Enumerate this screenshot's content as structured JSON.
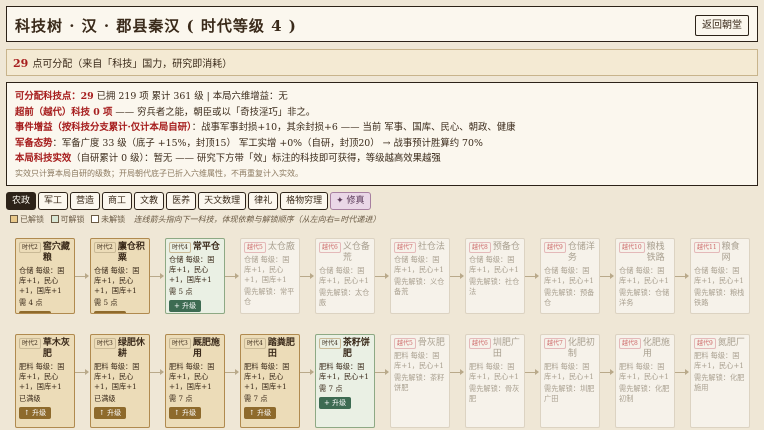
{
  "header": {
    "title": "科技树 · 汉 · 郡县秦汉 ( 时代等级 4 )",
    "back_label": "返回朝堂"
  },
  "points_bar": {
    "num": "29",
    "text": "点可分配（来自「科技」国力，研究即消耗）"
  },
  "stats": {
    "line1_label": "可分配科技点：29",
    "line1_rest": "   已拥 219 项   累计 361 级   |   本局六维增益：无",
    "line2_label": "超前（越代）科技 0 项",
    "line2_rest": " —— 穷兵者之能，朝臣或以「奇技淫巧」非之。",
    "line3_label": "事件增益（按科技分支累计·仅计本局自研）",
    "line3_rest": "：战事军事封损+10，其余封损+6 —— 当前 军事、国库、民心、朝政、健康",
    "line4_label": "军备态势",
    "line4_rest": "：军备广度 33 级（底子 +15%，封顶15）  军工实增 +0%（自研，封顶20） → 战事预计胜算约 70%",
    "line5_label": "本局科技实效",
    "line5_rest": "（自研累计 0 级）：暂无 —— 研究下方带「效」标注的科技即可获得，等级越高效果越强",
    "note": "实效只计算本局自研的级数；开局朝代底子已折入六维属性，不再重复计入实效。"
  },
  "tabs": [
    "农政",
    "军工",
    "营造",
    "商工",
    "文教",
    "医养",
    "天文数理",
    "律礼",
    "格物穷理",
    "✦ 修真"
  ],
  "legend": {
    "a": "已解锁",
    "b": "可解锁",
    "c": "未解锁",
    "hint": "连线箭头指向下一科技，体现依赖与解锁顺序（从左向右=时代递进）"
  },
  "cards": [
    {
      "badge": "时代2",
      "name": "窖穴藏粮",
      "desc": "仓储 每级：国库+1，民心+1，国库+1",
      "cost": "需 4 点",
      "btn": "↑ 升级",
      "state": "researched"
    },
    {
      "badge": "时代2",
      "name": "廪仓积粟",
      "desc": "仓储 每级：国库+1，民心+1，国库+1",
      "cost": "需 5 点",
      "btn": "↑ 升级",
      "state": "researched"
    },
    {
      "badge": "时代4",
      "name": "常平仓",
      "desc": "仓储 每级：国库+1，民心+1，国库+1",
      "cost": "需 5 点",
      "btn": "+ 升级",
      "state": "avail"
    },
    {
      "badge": "越代5",
      "name": "太仓廒",
      "desc": "仓储 每级：国库+1，民心+1，国库+1",
      "cost": "需先解锁：常平仓",
      "btn": "",
      "state": "locked"
    },
    {
      "badge": "越代6",
      "name": "义仓备荒",
      "desc": "仓储 每级：国库+1，民心+1",
      "cost": "需先解锁：太仓廒",
      "btn": "",
      "state": "locked"
    },
    {
      "badge": "越代7",
      "name": "社仓法",
      "desc": "仓储 每级：国库+1，民心+1",
      "cost": "需先解锁：义仓备荒",
      "btn": "",
      "state": "locked"
    },
    {
      "badge": "越代8",
      "name": "预备仓",
      "desc": "仓储 每级：国库+1，民心+1",
      "cost": "需先解锁：社仓法",
      "btn": "",
      "state": "locked"
    },
    {
      "badge": "越代9",
      "name": "仓储洋务",
      "desc": "仓储 每级：国库+1，民心+1",
      "cost": "需先解锁：预备仓",
      "btn": "",
      "state": "locked"
    },
    {
      "badge": "越代10",
      "name": "粮栈铁路",
      "desc": "仓储 每级：国库+1，民心+1",
      "cost": "需先解锁：仓储洋务",
      "btn": "",
      "state": "locked"
    },
    {
      "badge": "越代11",
      "name": "粮食网",
      "desc": "仓储 每级：国库+1，民心+1",
      "cost": "需先解锁：粮栈铁路",
      "btn": "",
      "state": "locked"
    },
    {
      "badge": "时代2",
      "name": "草木灰肥",
      "desc": "肥料 每级：国库+1，民心+1，国库+1",
      "cost": "已满级",
      "btn": "↑ 升级",
      "state": "researched"
    },
    {
      "badge": "时代3",
      "name": "绿肥休耕",
      "desc": "肥料 每级：国库+1，民心+1，国库+1",
      "cost": "已满级",
      "btn": "↑ 升级",
      "state": "researched"
    },
    {
      "badge": "时代3",
      "name": "厩肥施用",
      "desc": "肥料 每级：国库+1，民心+1，国库+1",
      "cost": "需 7 点",
      "btn": "↑ 升级",
      "state": "researched"
    },
    {
      "badge": "时代4",
      "name": "踏粪肥田",
      "desc": "肥料 每级：国库+1，民心+1，国库+1",
      "cost": "需 7 点",
      "btn": "↑ 升级",
      "state": "researched"
    },
    {
      "badge": "时代4",
      "name": "茶籽饼肥",
      "desc": "肥料 每级：国库+1，民心+1",
      "cost": "需 7 点",
      "btn": "+ 升级",
      "state": "avail"
    },
    {
      "badge": "越代5",
      "name": "骨灰肥",
      "desc": "肥料 每级：国库+1，民心+1",
      "cost": "需先解锁：茶籽饼肥",
      "btn": "",
      "state": "locked"
    },
    {
      "badge": "越代6",
      "name": "圳肥广田",
      "desc": "肥料 每级：国库+1，民心+1",
      "cost": "需先解锁：骨灰肥",
      "btn": "",
      "state": "locked"
    },
    {
      "badge": "越代7",
      "name": "化肥初制",
      "desc": "肥料 每级：国库+1，民心+1",
      "cost": "需先解锁：圳肥广田",
      "btn": "",
      "state": "locked"
    },
    {
      "badge": "越代8",
      "name": "化肥施用",
      "desc": "肥料 每级：国库+1，民心+1",
      "cost": "需先解锁：化肥初制",
      "btn": "",
      "state": "locked"
    },
    {
      "badge": "越代9",
      "name": "氮肥厂",
      "desc": "肥料 每级：国库+1，民心+1",
      "cost": "需先解锁：化肥施用",
      "btn": "",
      "state": "locked"
    }
  ]
}
